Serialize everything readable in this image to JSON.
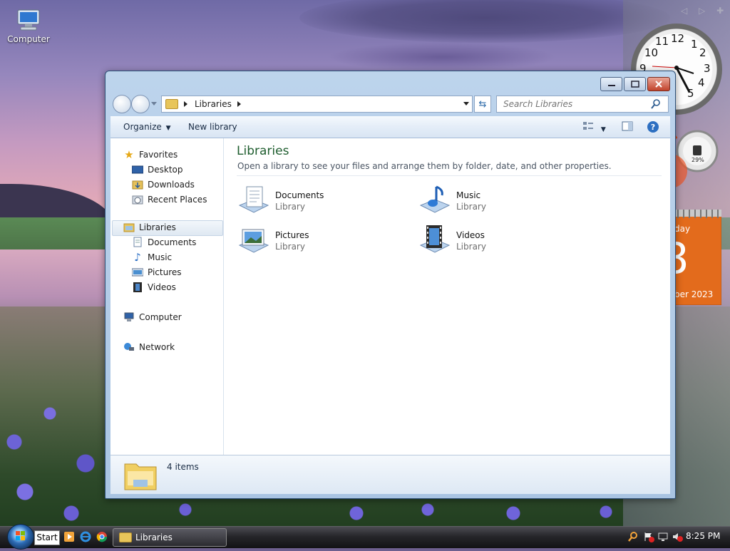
{
  "desktop": {
    "icon_label": "Computer"
  },
  "gadgets": {
    "clock_numbers": [
      "12",
      "1",
      "2",
      "3",
      "4",
      "5",
      "9",
      "10",
      "11"
    ],
    "meter_value": "29%",
    "calendar_day": "day",
    "calendar_date": "8",
    "calendar_month": "ber 2023"
  },
  "window": {
    "title": "Libraries",
    "address": {
      "crumb": "Libraries"
    },
    "search": {
      "placeholder": "Search Libraries"
    },
    "toolbar": {
      "organize_label": "Organize",
      "new_library_label": "New library"
    },
    "nav": {
      "favorites": "Favorites",
      "desktop": "Desktop",
      "downloads": "Downloads",
      "recent_places": "Recent Places",
      "libraries": "Libraries",
      "documents": "Documents",
      "music": "Music",
      "pictures": "Pictures",
      "videos": "Videos",
      "computer": "Computer",
      "network": "Network"
    },
    "main": {
      "title": "Libraries",
      "subtitle": "Open a library to see your files and arrange them by folder, date, and other properties.",
      "libraries": [
        {
          "name": "Documents",
          "kind": "Library"
        },
        {
          "name": "Music",
          "kind": "Library"
        },
        {
          "name": "Pictures",
          "kind": "Library"
        },
        {
          "name": "Videos",
          "kind": "Library"
        }
      ]
    },
    "details": {
      "count": "4 items"
    }
  },
  "taskbar": {
    "start_label": "Start",
    "task_label": "Libraries",
    "time": "8:25 PM"
  }
}
